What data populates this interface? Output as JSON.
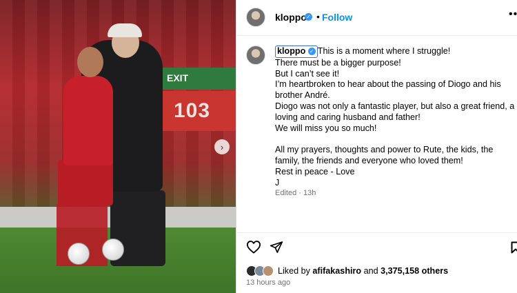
{
  "post": {
    "username": "kloppo",
    "follow_label": "Follow",
    "more_label": "•••",
    "next_label": "›",
    "photo_board_text": "103",
    "photo_green_text": "EXIT"
  },
  "caption": {
    "username": "kloppo",
    "lines": [
      "This is a moment where I struggle!",
      "There must be a bigger purpose!",
      "But I can’t see it!",
      "I’m heartbroken to hear about the passing of Diogo and his brother André.",
      "Diogo was not only a fantastic player, but also a great friend, a loving and caring husband and father!",
      "We will miss you so much!",
      "",
      "All my prayers, thoughts and power to Rute, the kids, the family, the friends and everyone who loved them!",
      "Rest in peace - Love",
      "J"
    ],
    "edited": "Edited · 13h"
  },
  "likes": {
    "prefix": "Liked by ",
    "user": "afifakashiro",
    "middle": " and ",
    "count": "3,375,158 others"
  },
  "timestamp": "13 hours ago",
  "colors": {
    "accent": "#0095f6",
    "verified": "#3897f0"
  }
}
